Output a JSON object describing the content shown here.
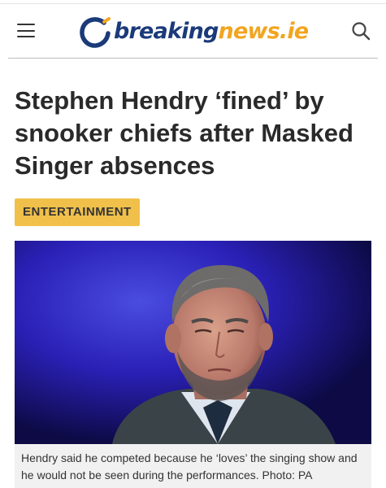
{
  "header": {
    "logo_icon": "breakingnews-logo-mark",
    "logo_text_part1": "breaking",
    "logo_text_part2": "news.ie",
    "menu_icon": "hamburger-menu-icon",
    "search_icon": "search-icon",
    "brand_colors": {
      "navy": "#1b3a7a",
      "orange": "#f2a51f"
    }
  },
  "article": {
    "headline": "Stephen Hendry ‘fined’ by snooker chiefs after Masked Singer absences",
    "category": "ENTERTAINMENT",
    "category_color": "#f0c04a",
    "caption": "Hendry said he competed because he ‘loves’ the singing show and he would not be seen during the performances. Photo: PA"
  }
}
